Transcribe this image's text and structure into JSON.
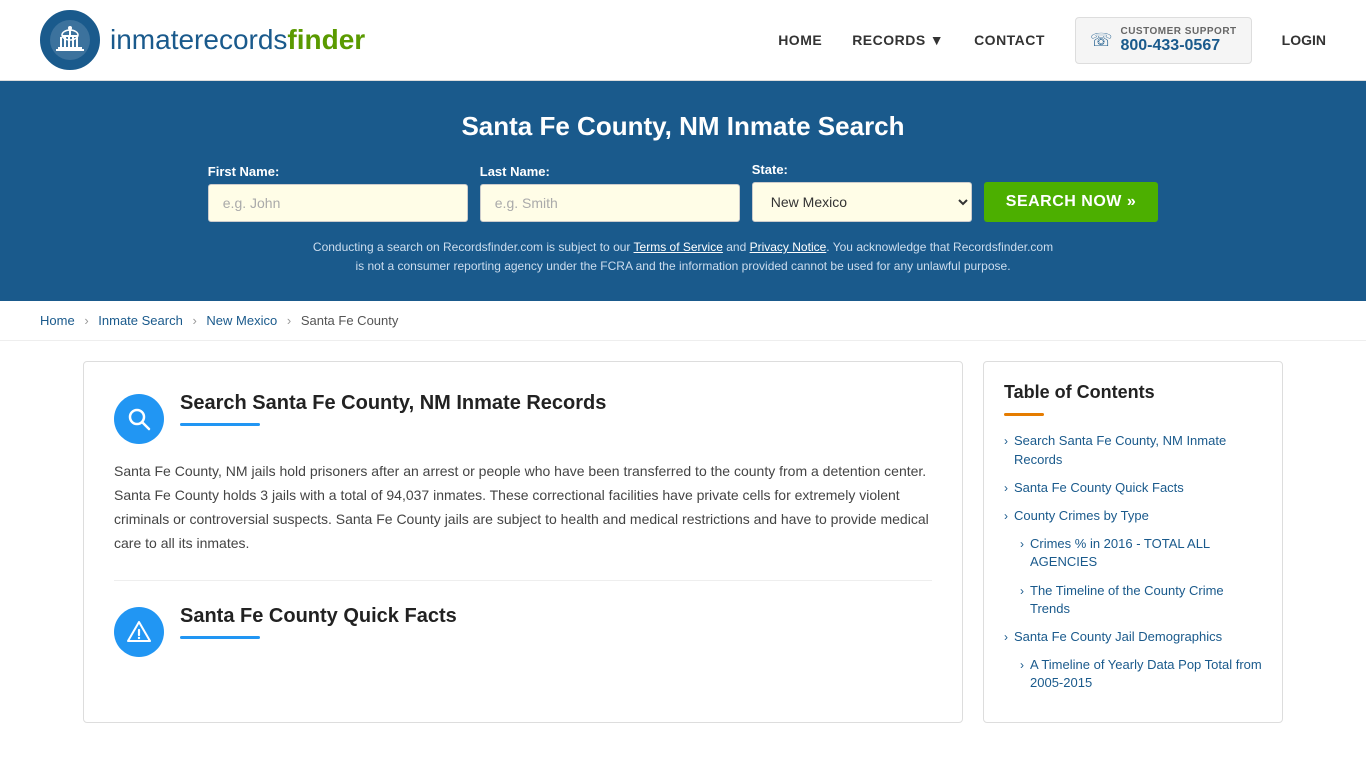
{
  "header": {
    "logo_text_thin": "inmaterecords",
    "logo_text_bold": "finder",
    "nav": {
      "home": "HOME",
      "records": "RECORDS",
      "contact": "CONTACT",
      "login": "LOGIN"
    },
    "customer_support": {
      "label": "CUSTOMER SUPPORT",
      "phone": "800-433-0567"
    }
  },
  "hero": {
    "title": "Santa Fe County, NM Inmate Search",
    "form": {
      "first_name_label": "First Name:",
      "first_name_placeholder": "e.g. John",
      "last_name_label": "Last Name:",
      "last_name_placeholder": "e.g. Smith",
      "state_label": "State:",
      "state_value": "New Mexico",
      "search_button": "SEARCH NOW »"
    },
    "disclaimer": "Conducting a search on Recordsfinder.com is subject to our Terms of Service and Privacy Notice. You acknowledge that Recordsfinder.com is not a consumer reporting agency under the FCRA and the information provided cannot be used for any unlawful purpose."
  },
  "breadcrumb": {
    "items": [
      "Home",
      "Inmate Search",
      "New Mexico",
      "Santa Fe County"
    ]
  },
  "main": {
    "section1": {
      "title": "Search Santa Fe County, NM Inmate Records",
      "body": "Santa Fe County, NM jails hold prisoners after an arrest or people who have been transferred to the county from a detention center. Santa Fe County holds 3 jails with a total of 94,037 inmates. These correctional facilities have private cells for extremely violent criminals or controversial suspects. Santa Fe County jails are subject to health and medical restrictions and have to provide medical care to all its inmates."
    },
    "section2": {
      "title": "Santa Fe County Quick Facts"
    }
  },
  "toc": {
    "title": "Table of Contents",
    "items": [
      {
        "text": "Search Santa Fe County, NM Inmate Records",
        "sub": false
      },
      {
        "text": "Santa Fe County Quick Facts",
        "sub": false
      },
      {
        "text": "County Crimes by Type",
        "sub": false
      },
      {
        "text": "Crimes % in 2016 - TOTAL ALL AGENCIES",
        "sub": true
      },
      {
        "text": "The Timeline of the County Crime Trends",
        "sub": true
      },
      {
        "text": "Santa Fe County Jail Demographics",
        "sub": false
      },
      {
        "text": "A Timeline of Yearly Data Pop Total from 2005-2015",
        "sub": true
      }
    ]
  }
}
